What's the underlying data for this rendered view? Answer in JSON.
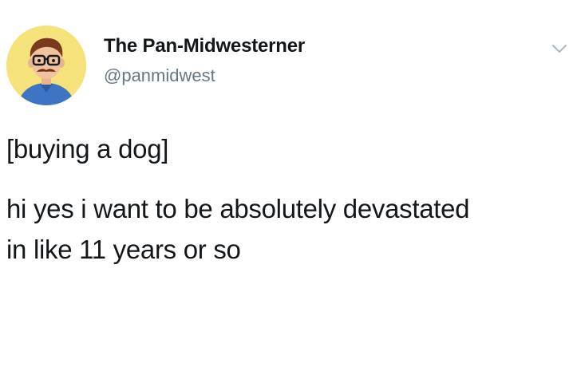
{
  "tweet": {
    "display_name": "The Pan-Midwesterner",
    "handle": "@panmidwest",
    "text_lines": [
      "[buying a dog]",
      "hi yes i want to be absolutely devastated",
      "in like 11 years or so"
    ],
    "menu_icon": "chevron-down-icon",
    "avatar_icon": "cartoon-man-avatar"
  },
  "colors": {
    "background": "#ffffff",
    "text": "#14171a",
    "secondary_text": "#657786",
    "avatar_background": "#f6e27a"
  }
}
